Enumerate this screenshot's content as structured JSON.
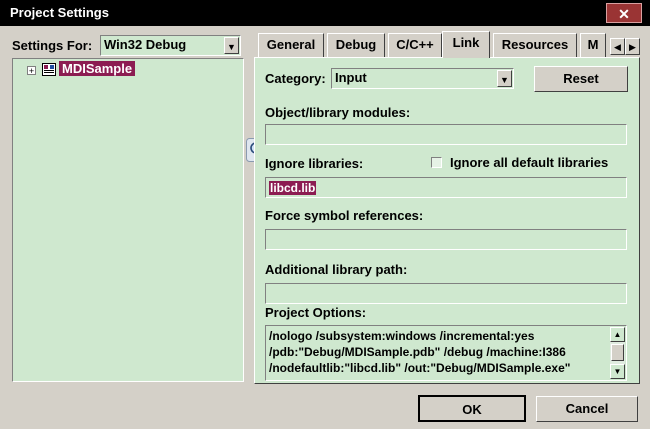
{
  "window": {
    "title": "Project Settings",
    "close_glyph": "✕"
  },
  "left": {
    "settings_for_label": "Settings For:",
    "settings_for_value": "Win32 Debug",
    "tree": {
      "expand_glyph": "+",
      "project": "MDISample"
    }
  },
  "tabs": [
    {
      "label": "General"
    },
    {
      "label": "Debug"
    },
    {
      "label": "C/C++"
    },
    {
      "label": "Link"
    },
    {
      "label": "Resources"
    },
    {
      "label": "M"
    }
  ],
  "tab_scroll": {
    "left_glyph": "◀",
    "right_glyph": "▶"
  },
  "link": {
    "category_label": "Category:",
    "category_value": "Input",
    "reset_label": "Reset",
    "object_modules_label": "Object/library modules:",
    "object_modules_value": "",
    "ignore_libs_label": "Ignore libraries:",
    "ignore_libs_value": "libcd.lib",
    "ignore_all_label": "Ignore all default libraries",
    "ignore_all_checked": false,
    "force_symbol_label": "Force symbol references:",
    "force_symbol_value": "",
    "additional_path_label": "Additional library path:",
    "additional_path_value": "",
    "project_options_label": "Project Options:",
    "project_options_lines": [
      "/nologo /subsystem:windows /incremental:yes",
      "/pdb:\"Debug/MDISample.pdb\" /debug /machine:I386",
      "/nodefaultlib:\"libcd.lib\" /out:\"Debug/MDISample.exe\""
    ]
  },
  "buttons": {
    "ok": "OK",
    "cancel": "Cancel"
  },
  "colors": {
    "field_bg": "#cfe8cf",
    "selection": "#8c1c52",
    "title_bg": "#000000",
    "close_bg": "#9a3434"
  }
}
